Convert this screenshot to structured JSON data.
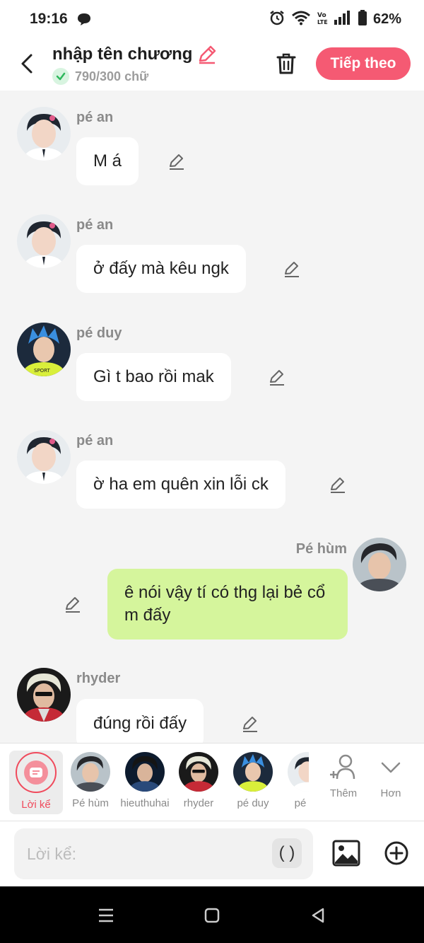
{
  "status_bar": {
    "time": "19:16",
    "battery": "62%",
    "icons": [
      "chat-bubble-icon",
      "alarm-icon",
      "wifi-icon",
      "volte-icon",
      "signal-icon",
      "battery-icon"
    ]
  },
  "header": {
    "title": "nhập tên chương",
    "word_count": "790/300 chữ",
    "next_button": "Tiếp theo",
    "accent_color": "#f55a73"
  },
  "messages": [
    {
      "sender": "pé an",
      "text": "M á",
      "mine": false,
      "avatar": "an"
    },
    {
      "sender": "pé an",
      "text": "ở đấy mà kêu ngk",
      "mine": false,
      "avatar": "an"
    },
    {
      "sender": "pé duy",
      "text": "Gì t bao rồi mak",
      "mine": false,
      "avatar": "duy"
    },
    {
      "sender": "pé an",
      "text": "ờ ha em quên xin lỗi ck",
      "mine": false,
      "avatar": "an"
    },
    {
      "sender": "Pé hùm",
      "text": "ê nói vậy tí có thg lại bẻ cổ m đấy",
      "mine": true,
      "avatar": "hum"
    },
    {
      "sender": "rhyder",
      "text": "đúng rồi đấy",
      "mine": false,
      "avatar": "rhyder"
    }
  ],
  "characters": {
    "narrator": "Lời kể",
    "list": [
      "Pé hùm",
      "hieuthuhai",
      "rhyder",
      "pé duy",
      "pé"
    ],
    "add_label": "Thêm",
    "more_label": "Hơn"
  },
  "composer": {
    "placeholder": "Lời kể:",
    "paren_button": "( )"
  },
  "colors": {
    "my_bubble": "#d5f59c",
    "other_bubble": "#ffffff",
    "background": "#f4f4f4"
  }
}
